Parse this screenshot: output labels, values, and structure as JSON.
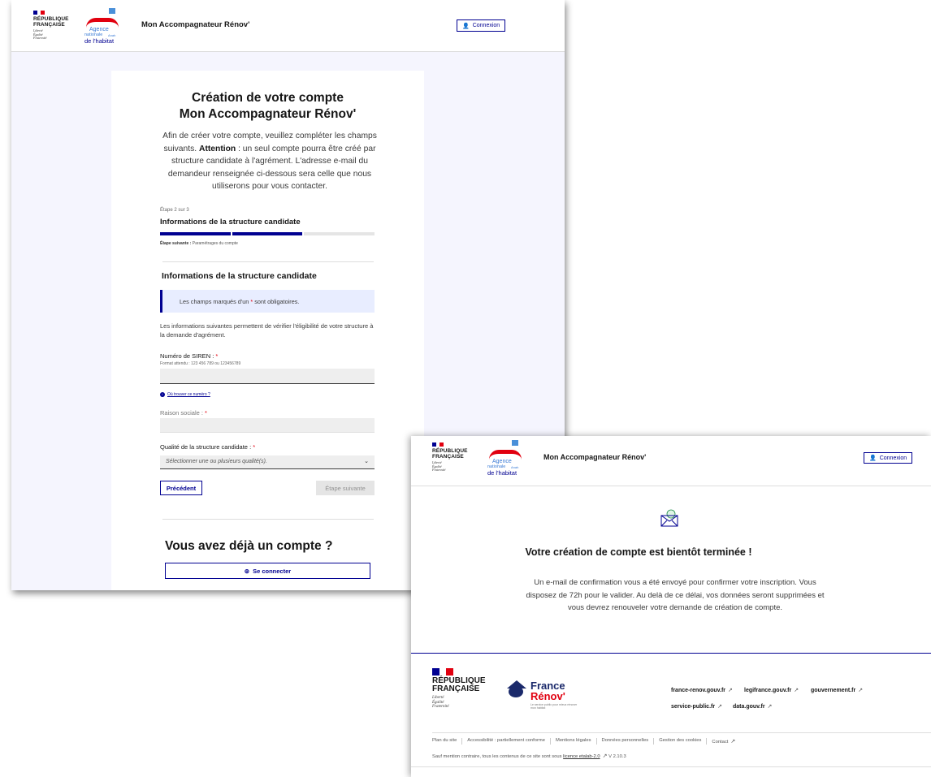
{
  "common": {
    "republic": [
      "RÉPUBLIQUE",
      "FRANÇAISE"
    ],
    "motto": [
      "Liberté",
      "Égalité",
      "Fraternité"
    ],
    "agency": {
      "line1": "Agence",
      "line2": "nationale",
      "line3": "de l'habitat",
      "side": "Anah"
    },
    "service_name": "Mon Accompagnateur Rénov'",
    "login_button": "Connexion",
    "colors": {
      "primary": "#000091",
      "red": "#e1000f",
      "bg_alt": "#f5f5fe",
      "notice_bg": "#e8edff"
    }
  },
  "signup": {
    "title_line1": "Création de votre compte",
    "title_line2": "Mon Accompagnateur Rénov'",
    "intro_start": "Afin de créer votre compte, veuillez compléter les champs suivants.",
    "intro_bold": "Attention",
    "intro_end": ": un seul compte pourra être créé par structure candidate à l'agrément. L'adresse e-mail du demandeur renseignée ci-dessous sera celle que nous utiliserons pour vous contacter.",
    "step_label": "Étape 2 sur 3",
    "step_title": "Informations de la structure candidate",
    "step_progress": {
      "current": 2,
      "total": 3
    },
    "next_step_label": "Étape suivante :",
    "next_step_value": "Paramétrages du compte",
    "section_title": "Informations de la structure candidate",
    "notice_start": "Les champs marqués d'un",
    "notice_star": "*",
    "notice_end": "sont obligatoires.",
    "description": "Les informations suivantes permettent de vérifier l'éligibilité de votre structure à la demande d'agrément.",
    "siren_label": "Numéro de SIREN :",
    "siren_hint": "Format attendu : 123 456 789 ou 123456789",
    "siren_value": "",
    "help_link": "Où trouver ce numéro ?",
    "raison_label": "Raison sociale :",
    "qualite_label": "Qualité de la structure candidate :",
    "qualite_placeholder": "Sélectionner une ou plusieurs qualité(s).",
    "required_mark": "*",
    "prev_button": "Précédent",
    "next_button": "Étape suivante",
    "have_account": "Vous avez déjà un compte ?",
    "se_connecter": "Se connecter"
  },
  "confirm": {
    "title": "Votre création de compte est bientôt terminée !",
    "text": "Un e-mail de confirmation vous a été envoyé pour confirmer votre inscription. Vous disposez de 72h pour le valider. Au delà de ce délai, vos données seront supprimées et vous devrez renouveler votre demande de création de compte.",
    "footer": {
      "france_renov": {
        "line1": "France",
        "line2": "Rénov'",
        "tagline": "Le service public pour mieux rénover mon habitat"
      },
      "links_row1": [
        "france-renov.gouv.fr",
        "legifrance.gouv.fr",
        "gouvernement.fr"
      ],
      "links_row2": [
        "service-public.fr",
        "data.gouv.fr"
      ],
      "bottom_links": [
        "Plan du site",
        "Accessibilité : partiellement conforme",
        "Mentions légales",
        "Données personnelles",
        "Gestion des cookies",
        "Contact"
      ],
      "license_start": "Sauf mention contraire, tous les contenus de ce site sont sous",
      "license_link": "licence etalab-2.0",
      "version": "V 2.10.3"
    }
  }
}
